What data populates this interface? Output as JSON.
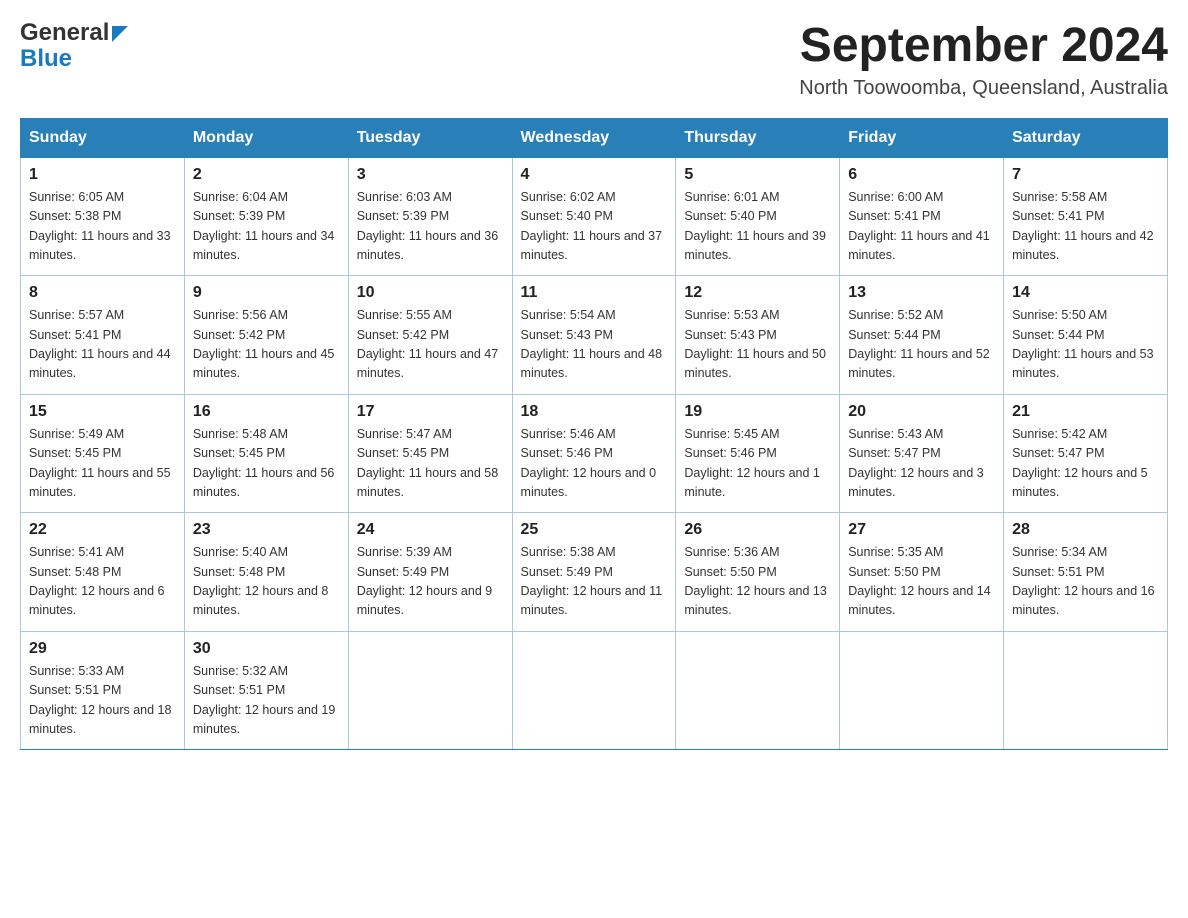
{
  "header": {
    "logo_line1": "General",
    "logo_line2": "Blue",
    "month_title": "September 2024",
    "location": "North Toowoomba, Queensland, Australia"
  },
  "days_of_week": [
    "Sunday",
    "Monday",
    "Tuesday",
    "Wednesday",
    "Thursday",
    "Friday",
    "Saturday"
  ],
  "weeks": [
    [
      {
        "day": "1",
        "sunrise": "6:05 AM",
        "sunset": "5:38 PM",
        "daylight": "11 hours and 33 minutes."
      },
      {
        "day": "2",
        "sunrise": "6:04 AM",
        "sunset": "5:39 PM",
        "daylight": "11 hours and 34 minutes."
      },
      {
        "day": "3",
        "sunrise": "6:03 AM",
        "sunset": "5:39 PM",
        "daylight": "11 hours and 36 minutes."
      },
      {
        "day": "4",
        "sunrise": "6:02 AM",
        "sunset": "5:40 PM",
        "daylight": "11 hours and 37 minutes."
      },
      {
        "day": "5",
        "sunrise": "6:01 AM",
        "sunset": "5:40 PM",
        "daylight": "11 hours and 39 minutes."
      },
      {
        "day": "6",
        "sunrise": "6:00 AM",
        "sunset": "5:41 PM",
        "daylight": "11 hours and 41 minutes."
      },
      {
        "day": "7",
        "sunrise": "5:58 AM",
        "sunset": "5:41 PM",
        "daylight": "11 hours and 42 minutes."
      }
    ],
    [
      {
        "day": "8",
        "sunrise": "5:57 AM",
        "sunset": "5:41 PM",
        "daylight": "11 hours and 44 minutes."
      },
      {
        "day": "9",
        "sunrise": "5:56 AM",
        "sunset": "5:42 PM",
        "daylight": "11 hours and 45 minutes."
      },
      {
        "day": "10",
        "sunrise": "5:55 AM",
        "sunset": "5:42 PM",
        "daylight": "11 hours and 47 minutes."
      },
      {
        "day": "11",
        "sunrise": "5:54 AM",
        "sunset": "5:43 PM",
        "daylight": "11 hours and 48 minutes."
      },
      {
        "day": "12",
        "sunrise": "5:53 AM",
        "sunset": "5:43 PM",
        "daylight": "11 hours and 50 minutes."
      },
      {
        "day": "13",
        "sunrise": "5:52 AM",
        "sunset": "5:44 PM",
        "daylight": "11 hours and 52 minutes."
      },
      {
        "day": "14",
        "sunrise": "5:50 AM",
        "sunset": "5:44 PM",
        "daylight": "11 hours and 53 minutes."
      }
    ],
    [
      {
        "day": "15",
        "sunrise": "5:49 AM",
        "sunset": "5:45 PM",
        "daylight": "11 hours and 55 minutes."
      },
      {
        "day": "16",
        "sunrise": "5:48 AM",
        "sunset": "5:45 PM",
        "daylight": "11 hours and 56 minutes."
      },
      {
        "day": "17",
        "sunrise": "5:47 AM",
        "sunset": "5:45 PM",
        "daylight": "11 hours and 58 minutes."
      },
      {
        "day": "18",
        "sunrise": "5:46 AM",
        "sunset": "5:46 PM",
        "daylight": "12 hours and 0 minutes."
      },
      {
        "day": "19",
        "sunrise": "5:45 AM",
        "sunset": "5:46 PM",
        "daylight": "12 hours and 1 minute."
      },
      {
        "day": "20",
        "sunrise": "5:43 AM",
        "sunset": "5:47 PM",
        "daylight": "12 hours and 3 minutes."
      },
      {
        "day": "21",
        "sunrise": "5:42 AM",
        "sunset": "5:47 PM",
        "daylight": "12 hours and 5 minutes."
      }
    ],
    [
      {
        "day": "22",
        "sunrise": "5:41 AM",
        "sunset": "5:48 PM",
        "daylight": "12 hours and 6 minutes."
      },
      {
        "day": "23",
        "sunrise": "5:40 AM",
        "sunset": "5:48 PM",
        "daylight": "12 hours and 8 minutes."
      },
      {
        "day": "24",
        "sunrise": "5:39 AM",
        "sunset": "5:49 PM",
        "daylight": "12 hours and 9 minutes."
      },
      {
        "day": "25",
        "sunrise": "5:38 AM",
        "sunset": "5:49 PM",
        "daylight": "12 hours and 11 minutes."
      },
      {
        "day": "26",
        "sunrise": "5:36 AM",
        "sunset": "5:50 PM",
        "daylight": "12 hours and 13 minutes."
      },
      {
        "day": "27",
        "sunrise": "5:35 AM",
        "sunset": "5:50 PM",
        "daylight": "12 hours and 14 minutes."
      },
      {
        "day": "28",
        "sunrise": "5:34 AM",
        "sunset": "5:51 PM",
        "daylight": "12 hours and 16 minutes."
      }
    ],
    [
      {
        "day": "29",
        "sunrise": "5:33 AM",
        "sunset": "5:51 PM",
        "daylight": "12 hours and 18 minutes."
      },
      {
        "day": "30",
        "sunrise": "5:32 AM",
        "sunset": "5:51 PM",
        "daylight": "12 hours and 19 minutes."
      },
      null,
      null,
      null,
      null,
      null
    ]
  ],
  "labels": {
    "sunrise": "Sunrise:",
    "sunset": "Sunset:",
    "daylight": "Daylight:"
  }
}
